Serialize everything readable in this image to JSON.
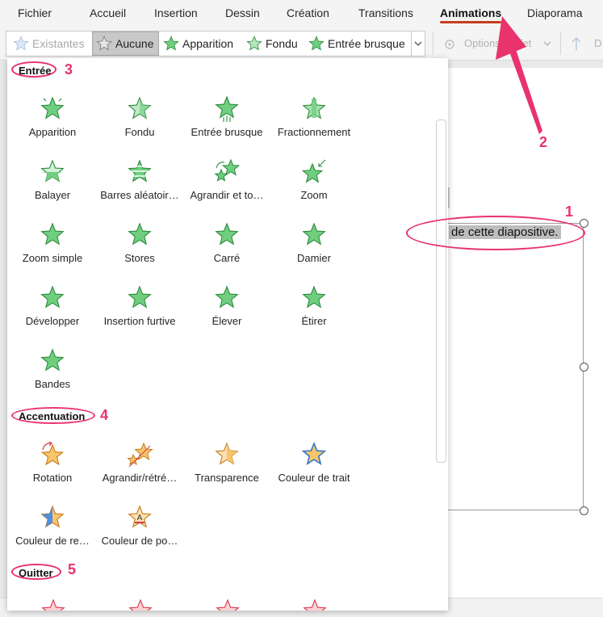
{
  "menu": {
    "tabs": [
      "Fichier",
      "Accueil",
      "Insertion",
      "Dessin",
      "Création",
      "Transitions",
      "Animations",
      "Diaporama"
    ],
    "active_tab": "Animations"
  },
  "ribbon": {
    "gallery": [
      {
        "label": "Existantes",
        "state": "disabled"
      },
      {
        "label": "Aucune",
        "state": "selected"
      },
      {
        "label": "Apparition",
        "state": "normal"
      },
      {
        "label": "Fondu",
        "state": "normal"
      },
      {
        "label": "Entrée brusque",
        "state": "normal"
      }
    ],
    "options_label": "Options d'effet",
    "truncated_label": "D"
  },
  "slide": {
    "text": "de cette diapositive."
  },
  "dropdown": {
    "sections": [
      {
        "title": "Entrée",
        "items": [
          "Apparition",
          "Fondu",
          "Entrée brusque",
          "Fractionnement",
          "Balayer",
          "Barres aléatoir…",
          "Agrandir et to…",
          "Zoom",
          "Zoom simple",
          "Stores",
          "Carré",
          "Damier",
          "Développer",
          "Insertion furtive",
          "Élever",
          "Étirer",
          "Bandes"
        ]
      },
      {
        "title": "Accentuation",
        "items": [
          "Rotation",
          "Agrandir/rétré…",
          "Transparence",
          "Couleur de trait",
          "Couleur de re…",
          "Couleur de po…"
        ]
      },
      {
        "title": "Quitter",
        "items": []
      }
    ]
  },
  "annotations": [
    "1",
    "2",
    "3",
    "4",
    "5"
  ],
  "colors": {
    "accent": "#e8336d",
    "tab_underline": "#c43e1c",
    "entry_star_fill": "#6fcf7f",
    "entry_star_stroke": "#2e8b3e",
    "emphasis_star_fill": "#f7c56a",
    "emphasis_star_stroke": "#c77a1a",
    "exit_star_stroke": "#d9384a"
  }
}
